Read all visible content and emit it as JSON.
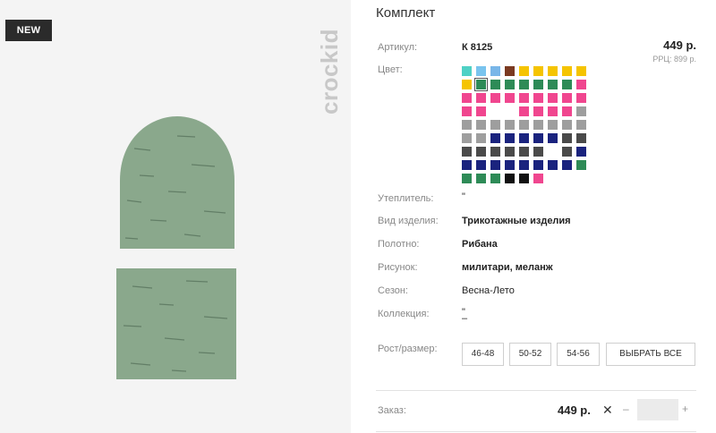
{
  "gallery": {
    "badge": "NEW",
    "brand": "crockid"
  },
  "product": {
    "title": "Комплект",
    "price": "449 р.",
    "rrp": "РРЦ: 899 р."
  },
  "attributes": {
    "article": {
      "label": "Артикул:",
      "value": "К 8125"
    },
    "color": {
      "label": "Цвет:"
    },
    "insulation": {
      "label": "Утеплитель:",
      "value": "\""
    },
    "type": {
      "label": "Вид изделия:",
      "value": "Трикотажные изделия"
    },
    "fabric": {
      "label": "Полотно:",
      "value": "Рибана"
    },
    "pattern": {
      "label": "Рисунок:",
      "value": "милитари, меланж"
    },
    "season": {
      "label": "Сезон:",
      "value": "Весна-Лето"
    },
    "collection": {
      "label": "Коллекция:",
      "value": "\"",
      "value2": "–"
    }
  },
  "swatch_rows": [
    [
      "#4fd1c5",
      "#79c4ee",
      "#79b6e8",
      "#7b3a21",
      "#f5c400",
      "#f5c400",
      "#f5c400",
      "#f5c400",
      "#f5c400"
    ],
    [
      "#f5c400",
      "#2e8b57",
      "#2e8b57",
      "#2e8b57",
      "#2e8b57",
      "#2e8b57",
      "#2e8b57",
      "#2e8b57",
      "#f0468f"
    ],
    [
      "#f0468f",
      "#f0468f",
      "#f0468f",
      "#f0468f",
      "#f0468f",
      "#f0468f",
      "#f0468f",
      "#f0468f",
      "#f0468f"
    ],
    [
      "#f0468f",
      "#f0468f",
      "#ffffff",
      "#ffffff",
      "#f0468f",
      "#f0468f",
      "#f0468f",
      "#f0468f",
      "#9e9e9e"
    ],
    [
      "#9e9e9e",
      "#9e9e9e",
      "#9e9e9e",
      "#9e9e9e",
      "#9e9e9e",
      "#9e9e9e",
      "#9e9e9e",
      "#9e9e9e",
      "#9e9e9e"
    ],
    [
      "#9e9e9e",
      "#9e9e9e",
      "#1a237e",
      "#1a237e",
      "#1a237e",
      "#1a237e",
      "#1a237e",
      "#4a4a4a",
      "#4a4a4a"
    ],
    [
      "#4a4a4a",
      "#4a4a4a",
      "#4a4a4a",
      "#4a4a4a",
      "#4a4a4a",
      "#4a4a4a",
      "#ffffff",
      "#4a4a4a",
      "#1a237e"
    ],
    [
      "#1a237e",
      "#1a237e",
      "#1a237e",
      "#1a237e",
      "#1a237e",
      "#1a237e",
      "#1a237e",
      "#1a237e",
      "#2e8b57"
    ],
    [
      "#2e8b57",
      "#2e8b57",
      "#2e8b57",
      "#111111",
      "#111111",
      "#f0468f"
    ]
  ],
  "selected_swatch": {
    "row": 1,
    "col": 1
  },
  "sizes": {
    "label": "Рост/размер:",
    "options": [
      "46-48",
      "50-52",
      "54-56"
    ],
    "select_all": "ВЫБРАТЬ ВСЕ"
  },
  "order": {
    "label": "Заказ:",
    "price": "449 р.",
    "remove": "✕",
    "minus": "–",
    "plus": "+",
    "qty": ""
  }
}
